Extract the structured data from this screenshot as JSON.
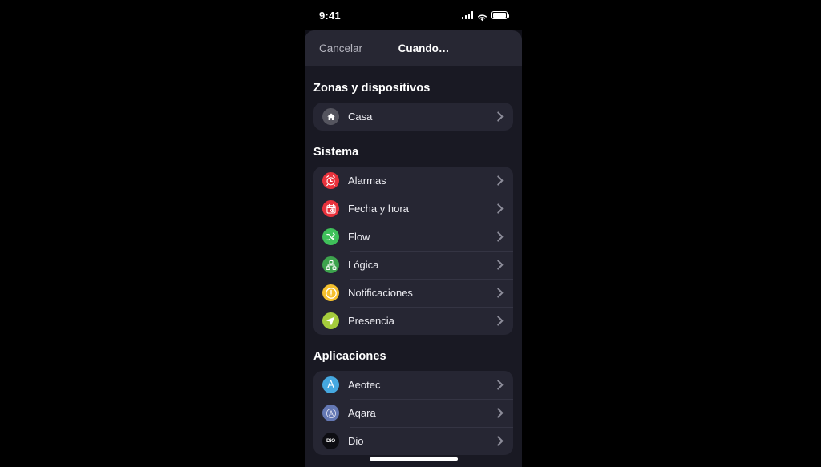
{
  "status_bar": {
    "time": "9:41",
    "icons": [
      "cellular-signal-icon",
      "wifi-icon",
      "battery-icon"
    ]
  },
  "navbar": {
    "cancel_label": "Cancelar",
    "title": "Cuando…"
  },
  "sections": [
    {
      "title": "Zonas y dispositivos",
      "rows": [
        {
          "label": "Casa",
          "icon": "home-icon",
          "color": "#55555f"
        }
      ]
    },
    {
      "title": "Sistema",
      "rows": [
        {
          "label": "Alarmas",
          "icon": "alarm-clock-icon",
          "color": "#e8323c"
        },
        {
          "label": "Fecha y hora",
          "icon": "calendar-clock-icon",
          "color": "#e8323c"
        },
        {
          "label": "Flow",
          "icon": "flow-shuffle-icon",
          "color": "#3fc05a"
        },
        {
          "label": "Lógica",
          "icon": "logic-nodes-icon",
          "color": "#3da34d"
        },
        {
          "label": "Notificaciones",
          "icon": "exclamation-circle-icon",
          "color": "#f5c02e"
        },
        {
          "label": "Presencia",
          "icon": "location-arrow-icon",
          "color": "#a5cc3c"
        }
      ]
    },
    {
      "title": "Aplicaciones",
      "rows": [
        {
          "label": "Aeotec",
          "icon": "aeotec-logo-icon",
          "color": "#45a8e0",
          "badge": "A"
        },
        {
          "label": "Aqara",
          "icon": "aqara-logo-icon",
          "color": "#6478b4",
          "badge": "A"
        },
        {
          "label": "Dio",
          "icon": "dio-logo-icon",
          "color": "#0d0d12",
          "badge": "DiO"
        }
      ]
    }
  ],
  "chevron_glyph": "›",
  "home_indicator": "home-indicator"
}
